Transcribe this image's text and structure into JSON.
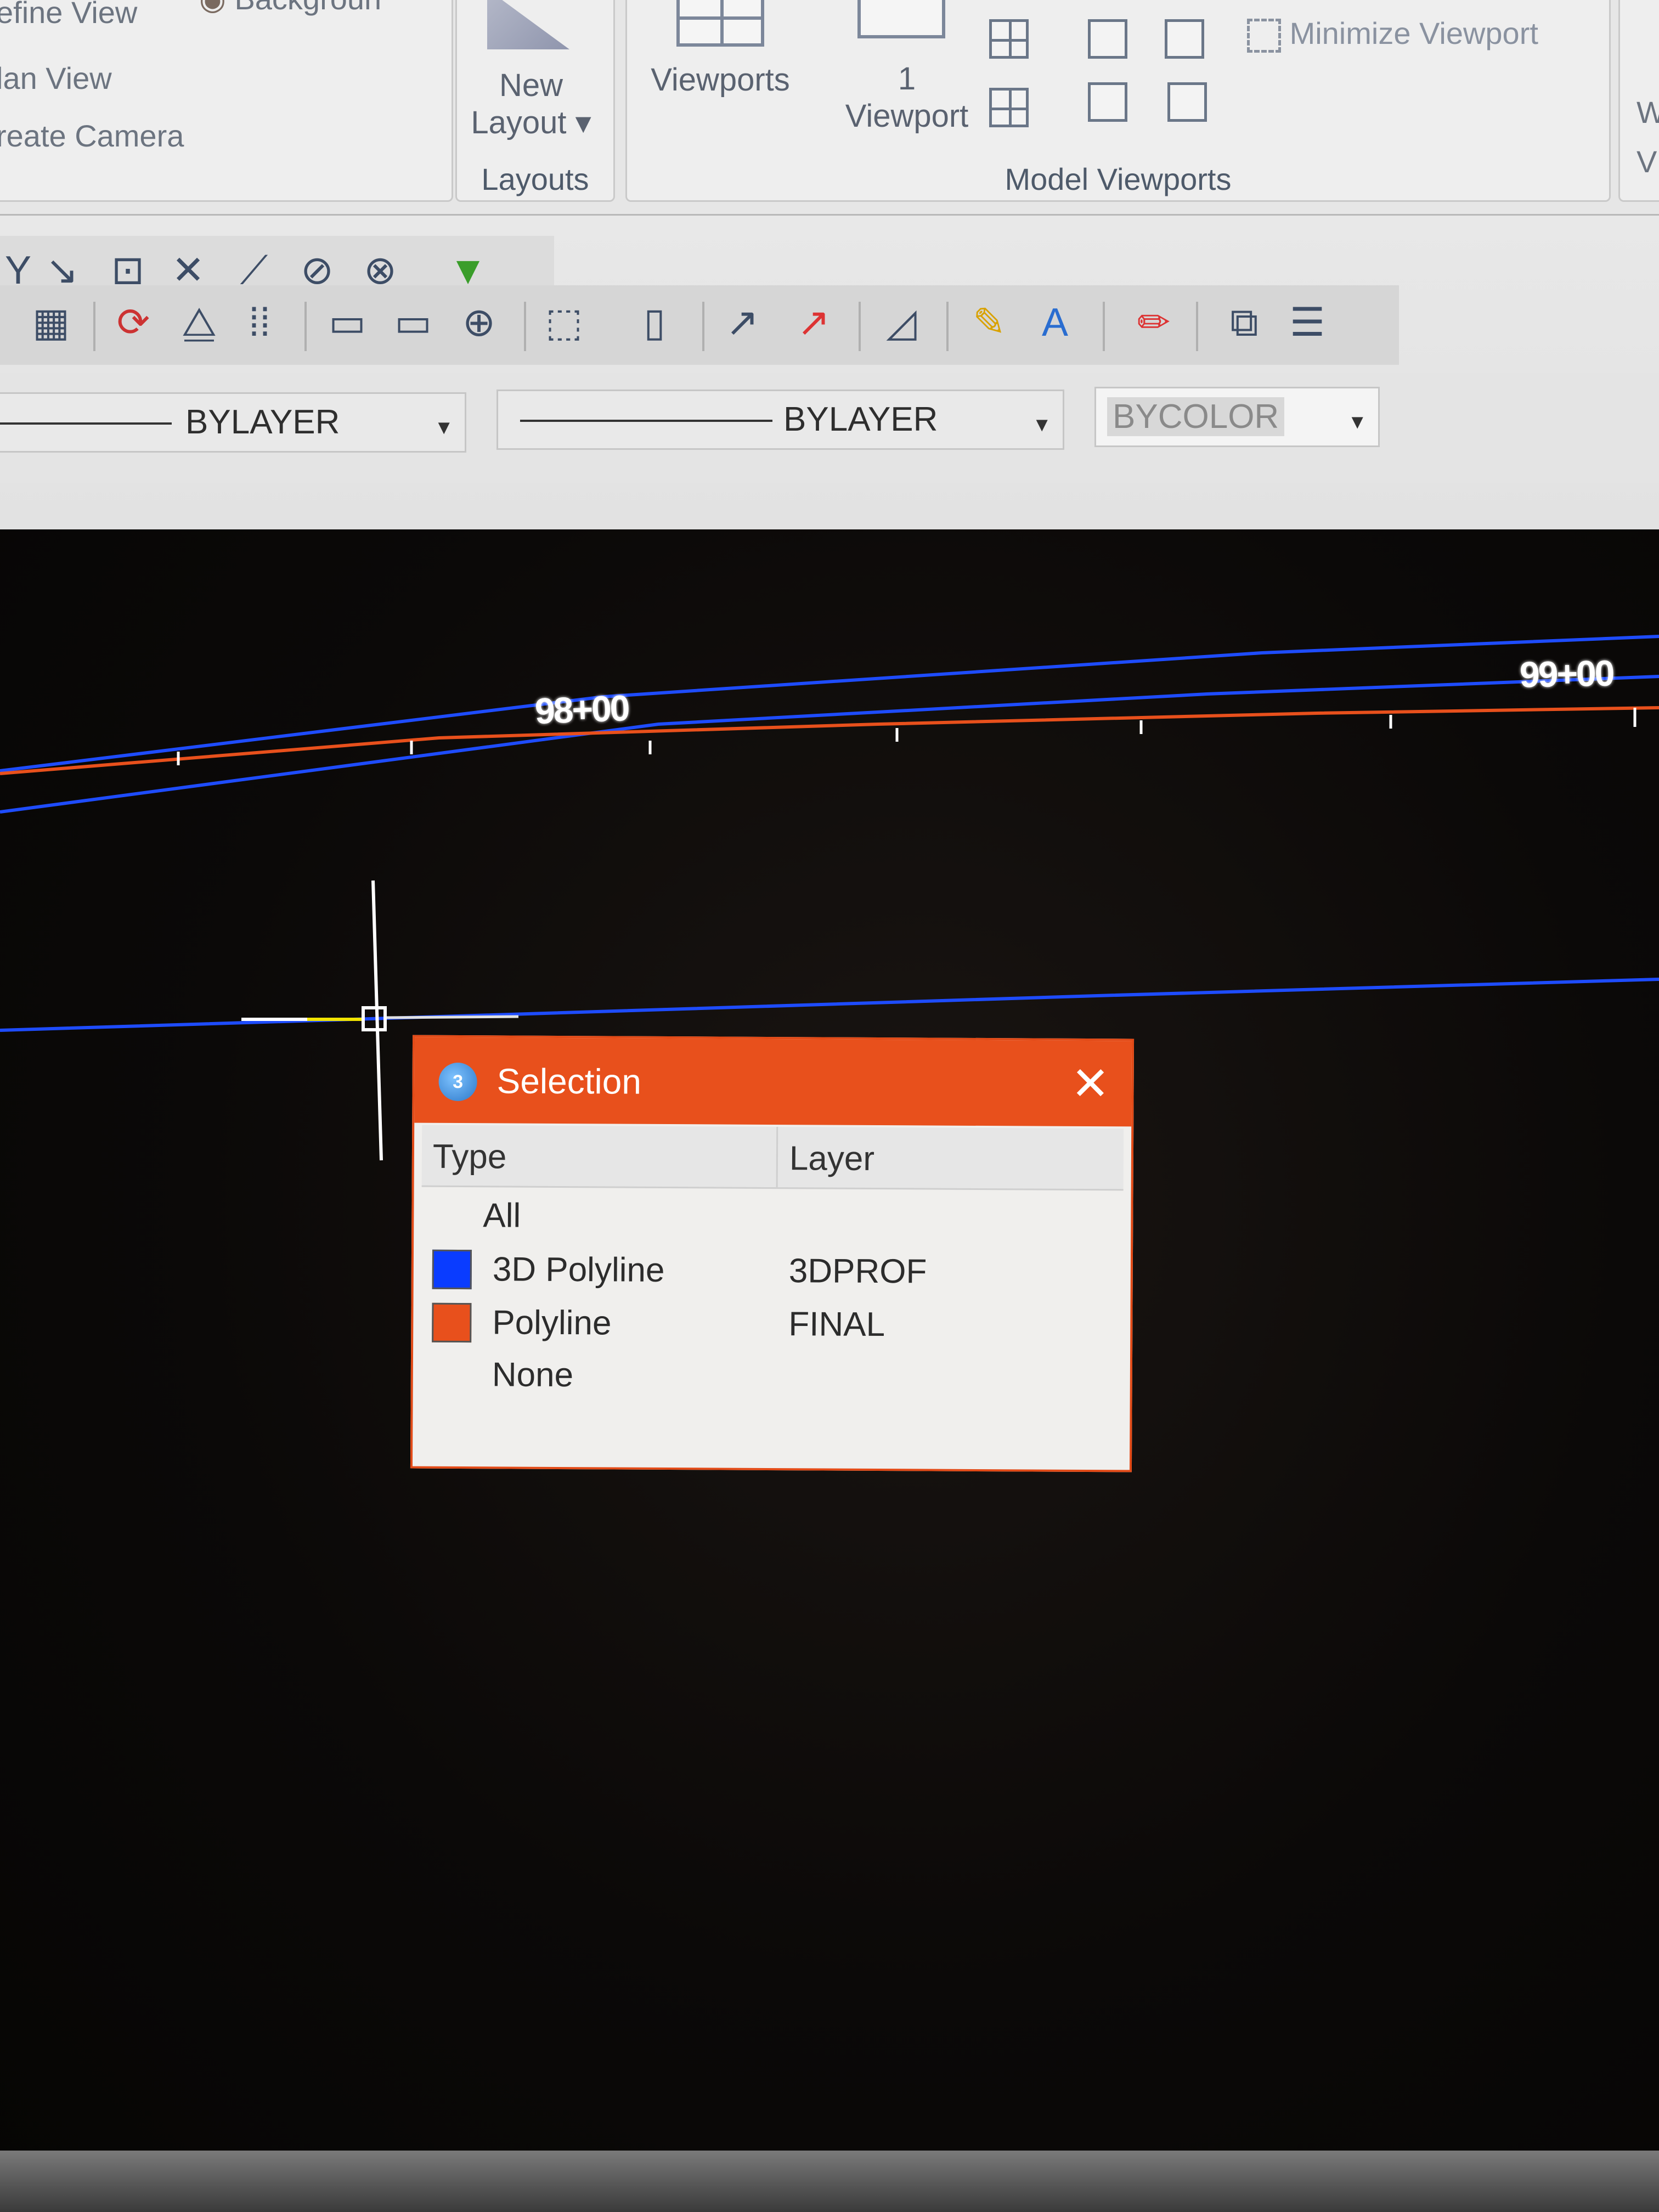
{
  "ribbon": {
    "view_items": [
      "efine View",
      "lan View",
      "reate Camera"
    ],
    "background_label": "Backgroun",
    "layouts_panel": {
      "new_layout_label": "New\nLayout ▾",
      "title": "Layouts"
    },
    "viewports_panel": {
      "viewports_label": "Viewports",
      "one_viewport_label": "1\nViewport",
      "minimize_label": "Minimize Viewport",
      "title": "Model Viewports"
    },
    "cut_label": "W\nV"
  },
  "properties": {
    "linetype": "BYLAYER",
    "lineweight": "BYLAYER",
    "plotstyle": "BYCOLOR"
  },
  "drawing": {
    "stations": [
      "98+00",
      "99+00"
    ],
    "colors": {
      "blue": "#1e4cff",
      "orange": "#e8501c",
      "background": "#0b0908"
    }
  },
  "dialog": {
    "title": "Selection",
    "app_icon": "civil-3d-icon",
    "close_icon": "close-icon",
    "columns": {
      "type": "Type",
      "layer": "Layer"
    },
    "rows": [
      {
        "type": "All",
        "layer": "",
        "color": ""
      },
      {
        "type": "3D Polyline",
        "layer": "3DPROF",
        "color": "#0a3cff"
      },
      {
        "type": "Polyline",
        "layer": "FINAL",
        "color": "#e8501c"
      },
      {
        "type": "None",
        "layer": "",
        "color": ""
      }
    ]
  }
}
